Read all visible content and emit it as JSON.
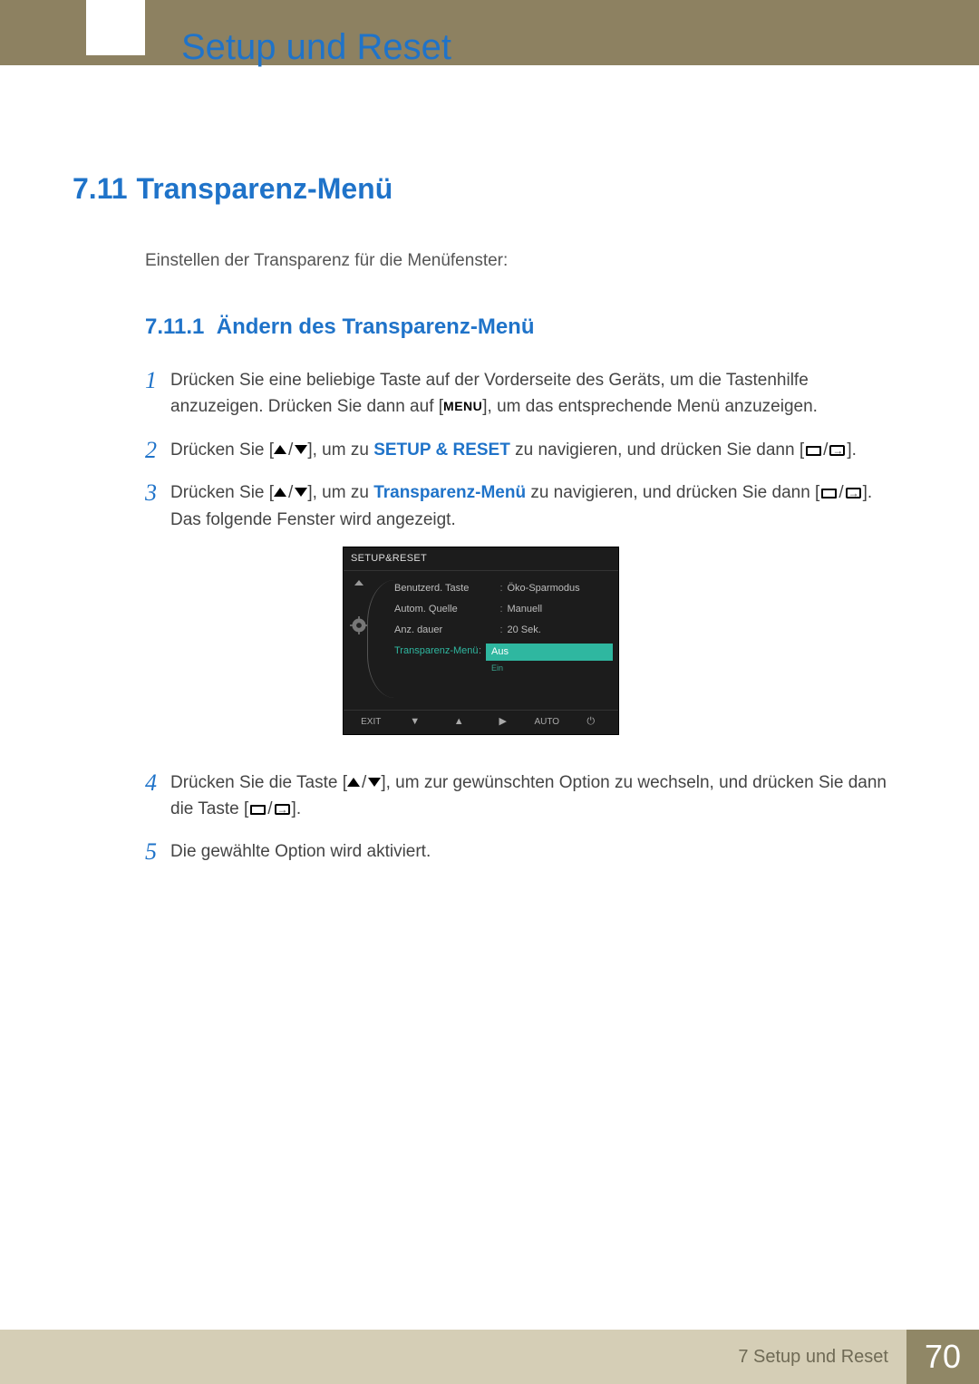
{
  "chapter_title": "Setup und Reset",
  "section": {
    "num": "7.11",
    "title": "Transparenz-Menü"
  },
  "intro": "Einstellen der Transparenz für die Menüfenster:",
  "subsection": {
    "num": "7.11.1",
    "title": "Ändern des Transparenz-Menü"
  },
  "steps": {
    "s1": {
      "part_a": "Drücken Sie eine beliebige Taste auf der Vorderseite des Geräts, um die Tastenhilfe anzuzeigen. Drücken Sie dann auf [",
      "menu_word": "MENU",
      "part_b": "], um das entsprechende Menü anzuzeigen."
    },
    "s2": {
      "a": "Drücken Sie [",
      "b": "], um zu ",
      "link": "SETUP & RESET",
      "c": " zu navigieren, und drücken Sie dann [",
      "d": "]."
    },
    "s3": {
      "a": "Drücken Sie [",
      "b": "], um zu ",
      "link": "Transparenz-Menü",
      "c": " zu navigieren, und drücken Sie dann [",
      "d": "]. Das folgende Fenster wird angezeigt."
    },
    "s4": {
      "a": "Drücken Sie die Taste [",
      "b": "], um zur gewünschten Option zu wechseln, und drücken Sie dann die Taste [",
      "c": "]."
    },
    "s5": {
      "a": "Die gewählte Option wird aktiviert."
    }
  },
  "osd": {
    "title": "SETUP&RESET",
    "rows": [
      {
        "label": "Benutzerd. Taste",
        "value": "Öko-Sparmodus"
      },
      {
        "label": "Autom. Quelle",
        "value": "Manuell"
      },
      {
        "label": "Anz. dauer",
        "value": "20 Sek."
      }
    ],
    "active_label": "Transparenz-Menü",
    "active_value": "Aus",
    "option_below": "Ein",
    "bottom": {
      "exit": "EXIT",
      "auto": "AUTO"
    }
  },
  "footer": {
    "crumb": "7 Setup und Reset",
    "page": "70"
  }
}
